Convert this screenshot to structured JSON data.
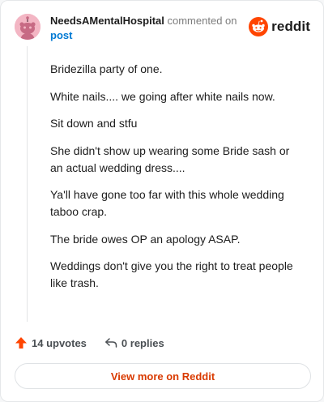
{
  "header": {
    "username": "NeedsAMentalHospital",
    "action": "commented on",
    "post_link": "post",
    "logo_text": "reddit"
  },
  "comment": {
    "paragraphs": [
      "Bridezilla party of one.",
      "White nails.... we going after white nails now.",
      "Sit down and stfu",
      "She didn't show up wearing some Bride sash or an actual wedding dress....",
      "Ya'll have gone too far with this whole wedding taboo crap.",
      "The bride owes OP an apology ASAP.",
      "Weddings don't give you the right to treat people like trash."
    ]
  },
  "footer": {
    "upvotes": "14 upvotes",
    "replies": "0 replies"
  },
  "view_more": "View more on Reddit",
  "icons": {
    "avatar": "snoo-avatar-icon",
    "logo": "reddit-logo-icon",
    "upvote": "upvote-arrow-icon",
    "reply": "reply-arrow-icon"
  },
  "colors": {
    "accent": "#ff4500",
    "link": "#0079d3",
    "view_more": "#d93a00",
    "avatar_bg": "#f3b6c4"
  }
}
